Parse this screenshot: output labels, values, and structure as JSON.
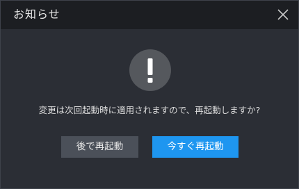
{
  "dialog": {
    "title": "お知らせ",
    "message": "変更は次回起動時に適用されますので、再起動しますか?",
    "icon": "exclamation-icon",
    "close_icon": "close-icon"
  },
  "buttons": {
    "later_label": "後で再起動",
    "now_label": "今すぐ再起動"
  },
  "colors": {
    "title_bar": "#1c1e22",
    "body": "#2b2e35",
    "icon_circle": "#55585d",
    "button_secondary": "#4b5059",
    "button_primary": "#1e96f0"
  }
}
